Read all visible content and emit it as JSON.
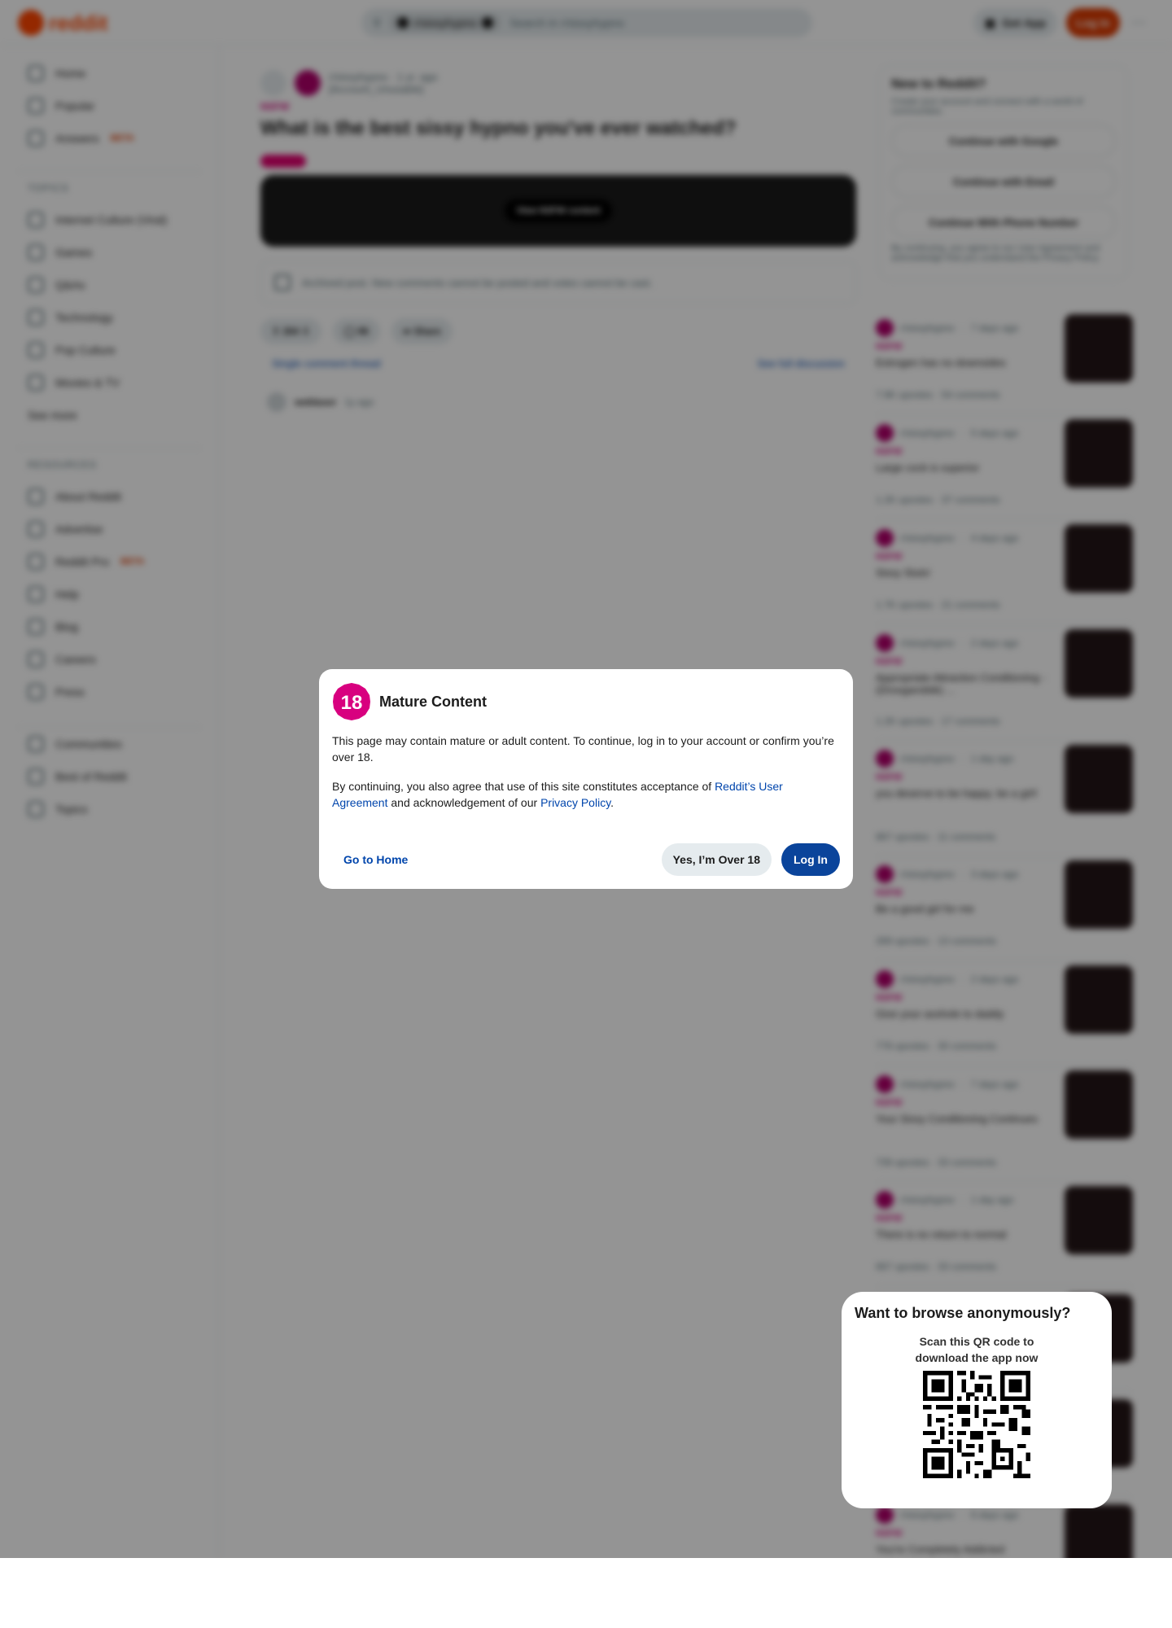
{
  "header": {
    "logo_text": "reddit",
    "search_chip": "r/sissyhypno",
    "search_placeholder": "Search in r/sissyhypno",
    "get_app": "Get App",
    "login": "Log In"
  },
  "leftnav": {
    "items": [
      {
        "label": "Home",
        "icon": "home-icon"
      },
      {
        "label": "Popular",
        "icon": "popular-icon"
      },
      {
        "label": "Answers",
        "icon": "answers-icon",
        "badge": "BETA"
      }
    ],
    "topics_title": "TOPICS",
    "topics": [
      "Internet Culture (Viral)",
      "Games",
      "Q&As",
      "Technology",
      "Pop Culture",
      "Movies & TV"
    ],
    "see_more": "See more",
    "resources_title": "RESOURCES",
    "resources": [
      {
        "label": "About Reddit"
      },
      {
        "label": "Advertise"
      },
      {
        "label": "Reddit Pro",
        "badge": "BETA"
      },
      {
        "label": "Help"
      },
      {
        "label": "Blog"
      },
      {
        "label": "Careers"
      },
      {
        "label": "Press"
      }
    ],
    "footer_links": [
      "Communities",
      "Best of Reddit",
      "Topics"
    ]
  },
  "post": {
    "subreddit": "r/sissyhypno",
    "age": "1 yr. ago",
    "author": "[Account_Unusable]",
    "nsfw": "NSFW",
    "title": "What is the best sissy hypno you've ever watched?",
    "view_nsfw": "View NSFW content",
    "archived_text": "Archived post. New comments cannot be posted and votes cannot be cast.",
    "votes": "264",
    "comments": "96",
    "share": "Share",
    "single_thread": "Single comment thread",
    "see_full": "See full discussion",
    "comment_author": "weblaser",
    "comment_age": "1y ago"
  },
  "signup": {
    "title": "New to Reddit?",
    "subtitle": "Create your account and connect with a world of communities.",
    "google": "Continue with Google",
    "email": "Continue with Email",
    "phone": "Continue With Phone Number",
    "legal": "By continuing, you agree to our User Agreement and acknowledge that you understand the Privacy Policy."
  },
  "related": [
    {
      "sub": "r/sissyhypno",
      "age": "7 days ago",
      "nsfw": "NSFW",
      "title": "Estrogen has no downsides",
      "stats": "7.9K upvotes · 54 comments"
    },
    {
      "sub": "r/sissyhypno",
      "age": "5 days ago",
      "nsfw": "NSFW",
      "title": "Large cock is superior",
      "stats": "1.2K upvotes · 37 comments"
    },
    {
      "sub": "r/sissyhypno",
      "age": "4 days ago",
      "nsfw": "NSFW",
      "title": "Sissy Sluts!",
      "stats": "1.7K upvotes · 21 comments"
    },
    {
      "sub": "r/sissyhypno",
      "age": "2 days ago",
      "nsfw": "NSFW",
      "title": "Appropriate Attraction Conditioning - (Droogarobtik) ...",
      "stats": "1.2K upvotes · 17 comments"
    },
    {
      "sub": "r/sissyhypno",
      "age": "1 day ago",
      "nsfw": "NSFW",
      "title": "you deserve to be happy. be a girl!",
      "stats": "867 upvotes · 11 comments"
    },
    {
      "sub": "r/sissyhypno",
      "age": "3 days ago",
      "nsfw": "NSFW",
      "title": "Be a good girl for me",
      "stats": "269 upvotes · 13 comments"
    },
    {
      "sub": "r/sissyhypno",
      "age": "2 days ago",
      "nsfw": "NSFW",
      "title": "Give your asshole to daddy",
      "stats": "778 upvotes · 30 comments"
    },
    {
      "sub": "r/sissyhypno",
      "age": "7 days ago",
      "nsfw": "NSFW",
      "title": "Your Sissy Conditioning Continues",
      "stats": "739 upvotes · 33 comments"
    },
    {
      "sub": "r/sissyhypno",
      "age": "1 day ago",
      "nsfw": "NSFW",
      "title": "There is no return to normal",
      "stats": "667 upvotes · 33 comments"
    }
  ],
  "related_last": {
    "sub": "r/sissyhypno",
    "age": "6 days ago",
    "nsfw": "NSFW",
    "title": "You're Completely Addicted"
  },
  "modal": {
    "badge": "18",
    "title": "Mature Content",
    "body1": "This page may contain mature or adult content. To continue, log in to your account or confirm you’re over 18.",
    "body2_prefix": "By continuing, you also agree that use of this site constitutes acceptance of ",
    "user_agreement": "Reddit’s User Agreement",
    "body2_mid": " and acknowledgement of our ",
    "privacy_policy": "Privacy Policy",
    "body2_suffix": ".",
    "go_home": "Go to Home",
    "over18": "Yes, I’m Over 18",
    "login": "Log In"
  },
  "qr": {
    "title": "Want to browse anonymously?",
    "line1": "Scan this QR code to",
    "line2": "download the app now"
  },
  "colors": {
    "accent": "#ff4500",
    "modal_login": "#0a449b",
    "link": "#0045ac",
    "nsfw": "#d0007a"
  }
}
